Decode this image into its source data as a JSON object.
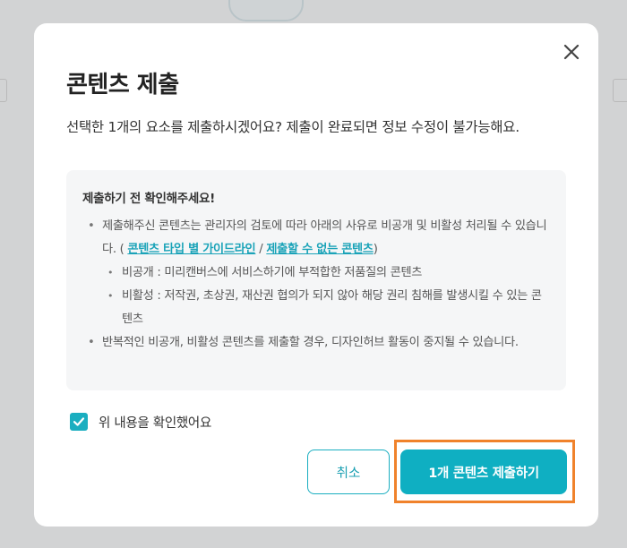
{
  "dialog": {
    "title": "콘텐츠 제출",
    "description": "선택한 1개의 요소를 제출하시겠어요? 제출이 완료되면 정보 수정이 불가능해요.",
    "close_icon": "close-icon"
  },
  "notice": {
    "title": "제출하기 전 확인해주세요!",
    "item1_text": "제출해주신 콘텐츠는 관리자의 검토에 따라 아래의 사유로 비공개 및 비활성 처리될 수 있습니다. ( ",
    "item1_link1": "콘텐츠 타입 별 가이드라인",
    "item1_separator": " / ",
    "item1_link2": "제출할 수 없는 콘텐츠",
    "item1_close": ")",
    "sub_items": [
      "비공개 : 미리캔버스에 서비스하기에 부적합한 저품질의 콘텐츠",
      "비활성 : 저작권, 초상권, 재산권 협의가 되지 않아 해당 권리 침해를 발생시킬 수 있는 콘텐츠"
    ],
    "item2_text": "반복적인 비공개, 비활성 콘텐츠를 제출할 경우, 디자인허브 활동이 중지될 수 있습니다."
  },
  "confirm": {
    "label": "위 내용을 확인했어요",
    "checked": true
  },
  "actions": {
    "cancel_label": "취소",
    "submit_label": "1개 콘텐츠 제출하기"
  },
  "colors": {
    "accent": "#0fafc2",
    "highlight": "#f0822b",
    "link": "#1aa3b8"
  }
}
